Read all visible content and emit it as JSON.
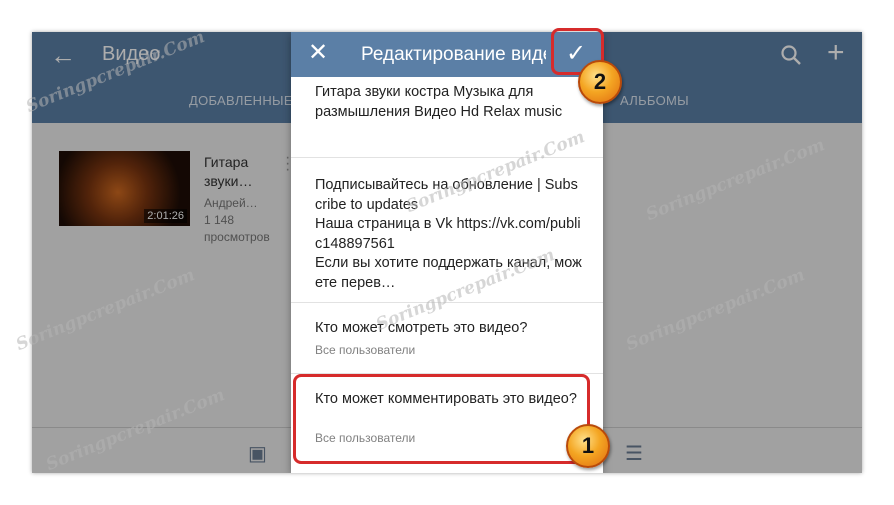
{
  "app": {
    "title": "Видео",
    "tabs": [
      "ДОБАВЛЕННЫЕ",
      "АЛЬБОМЫ"
    ]
  },
  "video": {
    "title": "Гитара звуки…",
    "author": "Андрей…",
    "views": "1 148 просмотров",
    "duration": "2:01:26"
  },
  "dialog": {
    "title": "Редактирование видео",
    "video_title": "Гитара звуки костра Музыка для размышления Видео Hd Relax music",
    "description": "Подписывайтесь на обновление | Subscribe to updates\nНаша страница в Vk https://vk.com/public148897561\nЕсли вы хотите поддержать канал, можете перев…",
    "privacy_view": {
      "label": "Кто может смотреть это видео?",
      "value": "Все пользователи"
    },
    "privacy_comment": {
      "label": "Кто может комментировать это видео?",
      "value": "Все пользователи"
    }
  },
  "callouts": {
    "one": "1",
    "two": "2"
  },
  "watermark": "Soringpcrepair.Com",
  "colors": {
    "appbar": "#5b7fa6",
    "callout_red": "#d62b2b",
    "badge_orange": "#f4a623"
  }
}
